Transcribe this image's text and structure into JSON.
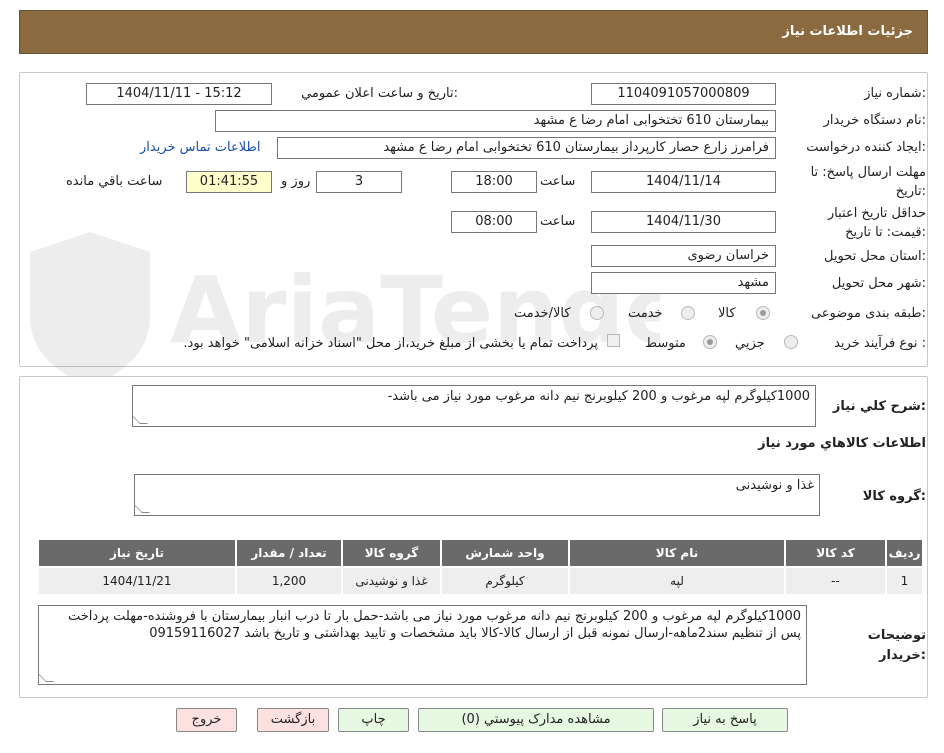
{
  "header": {
    "title": "جزئیات اطلاعات نیاز"
  },
  "form": {
    "need_number": {
      "label": "شماره نیاز:",
      "value": "1104091057000809"
    },
    "announce": {
      "label": "تاریخ و ساعت اعلان عمومي:",
      "value": "1404/11/11 - 15:12"
    },
    "buyer_org": {
      "label": "نام دستگاه خريدار:",
      "value": "بیمارستان 610 تختخوابی امام رضا ع  مشهد"
    },
    "requester": {
      "label": "ايجاد کننده درخواست:",
      "value": "فرامرز زارع حصار کارپرداز بیمارستان 610 تختخوابی امام رضا ع  مشهد",
      "contact_link": "اطلاعات تماس خريدار"
    },
    "deadline": {
      "label_line1": "مهلت ارسال پاسخ: تا",
      "label_line2": "تاریخ:",
      "date": "1404/11/14",
      "time_label": "ساعت",
      "time": "18:00",
      "days": "3",
      "days_label": "روز و",
      "remaining": "01:41:55",
      "remaining_label": "ساعت باقي مانده"
    },
    "validity": {
      "label_line1": "حداقل تاریخ اعتبار",
      "label_line2": "قیمت: تا تاریخ:",
      "date": "1404/11/30",
      "time_label": "ساعت",
      "time": "08:00"
    },
    "province": {
      "label": "استان محل تحویل:",
      "value": "خراسان رضوی"
    },
    "city": {
      "label": "شهر محل تحویل:",
      "value": "مشهد"
    },
    "category": {
      "label": "طبقه بندی موضوعی:",
      "options": [
        "کالا",
        "خدمت",
        "کالا/خدمت"
      ],
      "selected": "کالا"
    },
    "process": {
      "label": "نوع فرآیند خرید :",
      "options": [
        "جزیي",
        "متوسط"
      ],
      "selected": "جزیي",
      "payment_note": "پرداخت تمام یا بخشی از مبلغ خرید،از محل \"اسناد خزانه اسلامی\" خواهد بود."
    }
  },
  "description": {
    "label": "شرح کلي نياز:",
    "value": "1000کیلوگرم لپه مرغوب و 200 کیلوبرنج نیم دانه مرغوب مورد نیاز می باشد-"
  },
  "goods": {
    "section_title": "اطلاعات کالاهاي مورد نياز",
    "group_label": "گروه کالا:",
    "group_value": "غذا و نوشیدنی",
    "table": {
      "columns": [
        "رديف",
        "کد کالا",
        "نام کالا",
        "واحد شمارش",
        "گروه کالا",
        "تعداد / مقدار",
        "تاریخ نیاز"
      ],
      "rows": [
        [
          "1",
          "--",
          "لپه",
          "کیلوگرم",
          "غذا و نوشیدنی",
          "1,200",
          "1404/11/21"
        ]
      ]
    },
    "buyer_notes_label_1": "توضیحات",
    "buyer_notes_label_2": "خریدار:",
    "buyer_notes": "1000کیلوگرم لپه مرغوب و 200 کیلوبرنج نیم دانه مرغوب مورد نیاز می باشد-حمل بار تا درب انبار بیمارستان با فروشنده-مهلت پرداخت پس از تنظیم سند2ماهه-ارسال نمونه قبل از ارسال کالا-کالا باید مشخصات و تایید بهداشتی و تاریخ باشد 09159116027"
  },
  "buttons": {
    "reply": "پاسخ به نیاز",
    "attachments": "مشاهده مدارک پیوستي (0)",
    "print": "چاپ",
    "back": "بازگشت",
    "exit": "خروج"
  },
  "watermark": {
    "text": "AriaTender.neT"
  }
}
